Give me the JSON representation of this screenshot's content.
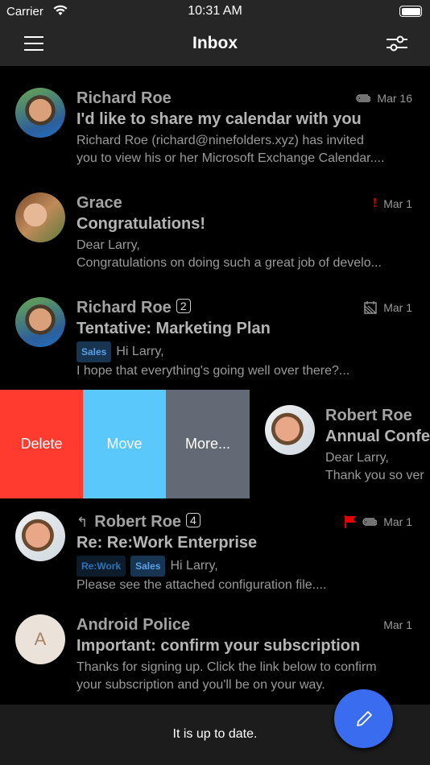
{
  "status_bar": {
    "carrier": "Carrier",
    "time": "10:31 AM"
  },
  "nav": {
    "title": "Inbox"
  },
  "messages": [
    {
      "sender": "Richard Roe",
      "date": "Mar 16",
      "subject": "I'd like to share my calendar with you",
      "preview1": "Richard Roe (richard@ninefolders.xyz) has invited",
      "preview2": "you to view his or her Microsoft Exchange Calendar....",
      "icons": [
        "attachment-icon"
      ]
    },
    {
      "sender": "Grace",
      "date": "Mar 1",
      "subject": "Congratulations!",
      "preview1": "Dear Larry,",
      "preview2": "Congratulations on doing such a great job of develo...",
      "icons": [
        "important-icon"
      ]
    },
    {
      "sender": "Richard Roe",
      "count": "2",
      "date": "Mar 1",
      "subject": "Tentative: Marketing Plan",
      "tags": [
        "Sales"
      ],
      "preview1": "Hi Larry,",
      "preview2": "I hope that everything's going well over there?...",
      "icons": [
        "calendar-tentative-icon"
      ]
    },
    {
      "sender": "Robert Roe",
      "subject": "Annual Confe",
      "preview1": "Dear Larry,",
      "preview2": "Thank you so ver"
    },
    {
      "sender": "Robert Roe",
      "count": "4",
      "date": "Mar 1",
      "subject": "Re: Re:Work Enterprise",
      "tags": [
        "Re:Work",
        "Sales"
      ],
      "preview1": "Hi Larry,",
      "preview2": "Please see the attached configuration file....",
      "icons": [
        "reply-icon",
        "flag-icon",
        "attachment-icon"
      ]
    },
    {
      "sender": "Android Police",
      "avatar_letter": "A",
      "date": "Mar 1",
      "subject": "Important: confirm your subscription",
      "preview1": "Thanks for signing up. Click the link below to confirm",
      "preview2": "your subscription and you'll be on your way."
    }
  ],
  "swipe_actions": {
    "delete": "Delete",
    "move": "Move",
    "more": "More..."
  },
  "colors": {
    "delete": "#ff3b30",
    "move": "#5ac8fa",
    "more": "#636a75",
    "fab": "#3a6cf0",
    "flag": "#e00000"
  },
  "bottom_status": "It is up to date."
}
